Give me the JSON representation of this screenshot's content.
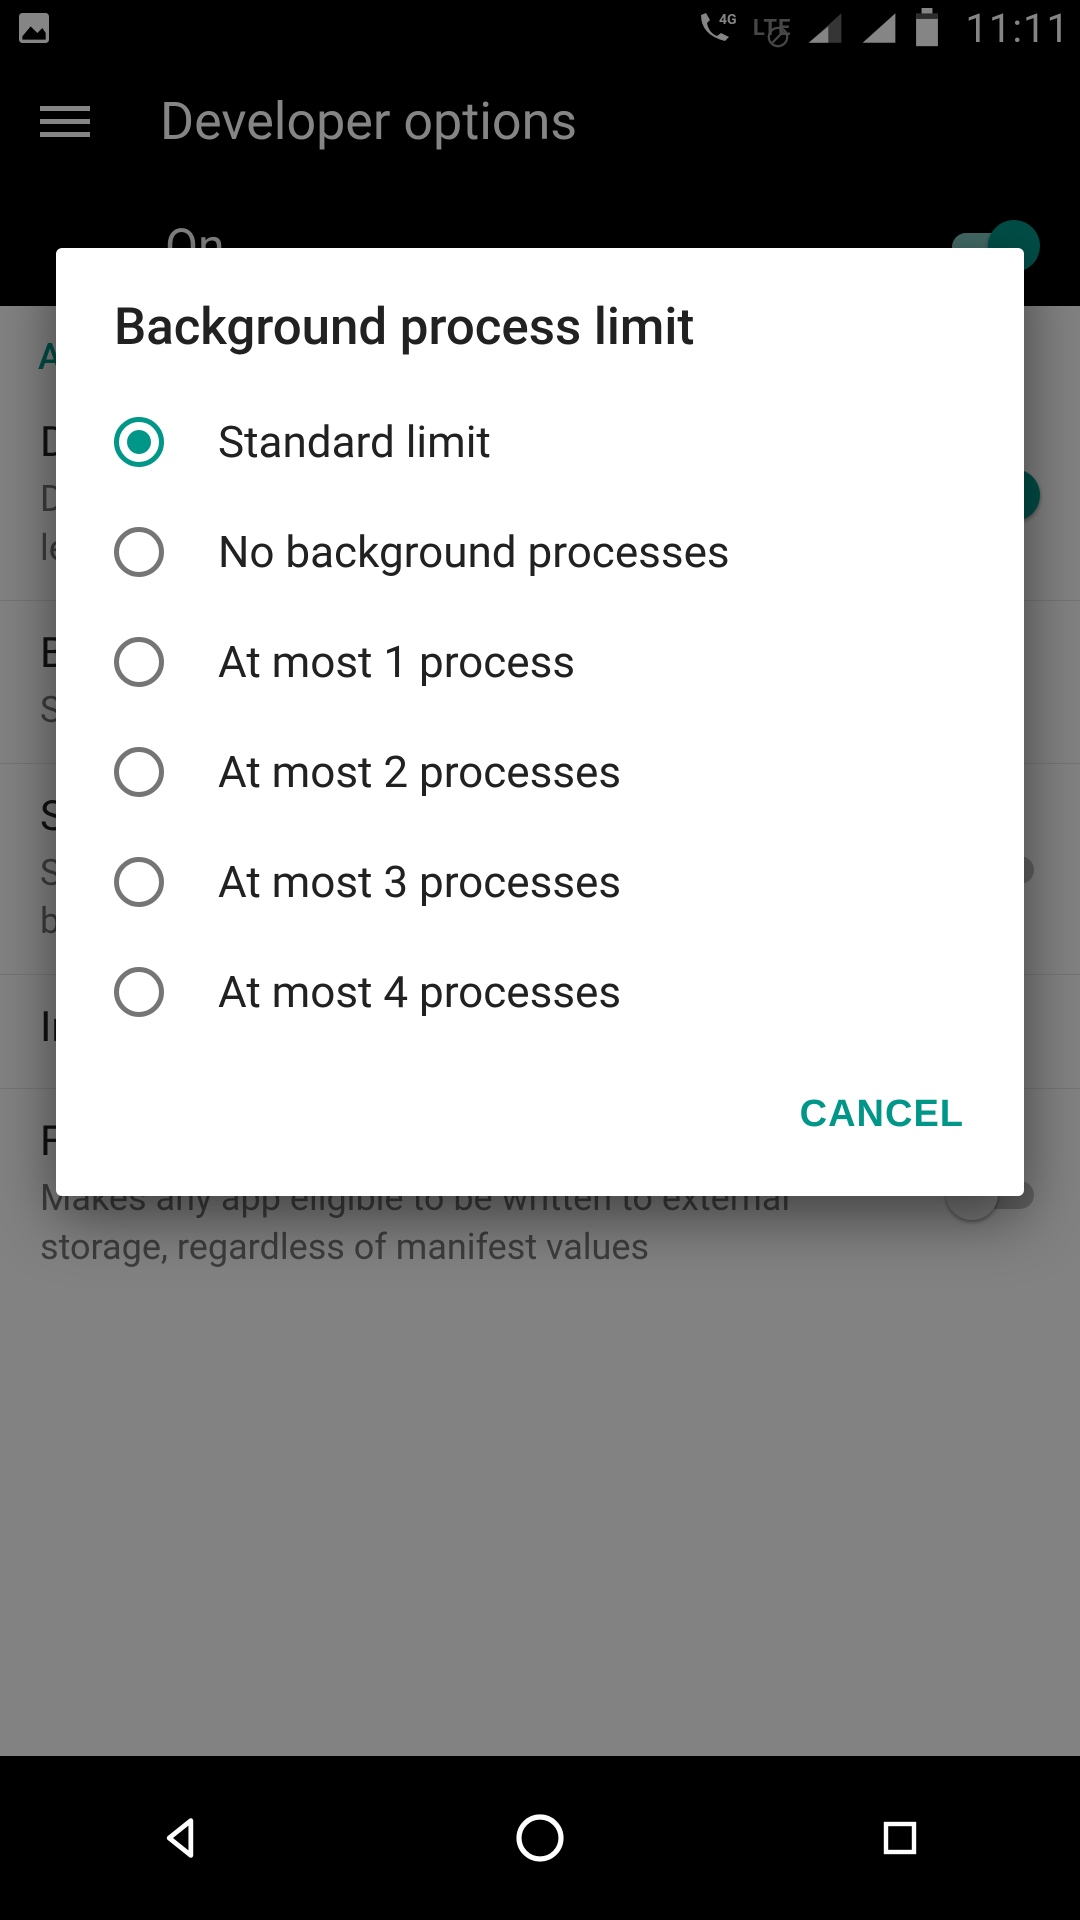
{
  "statusbar": {
    "time": "11:11",
    "network_label": "4G",
    "lte_label": "LTE"
  },
  "appbar": {
    "title": "Developer options"
  },
  "master_toggle": {
    "label": "On"
  },
  "sections": {
    "apps_header": "Apps"
  },
  "settings": {
    "dont_keep": {
      "title": "Don't keep activities",
      "subtitle": "Destroy every activity as soon as the user leaves it"
    },
    "bg_limit": {
      "title": "Background process limit",
      "subtitle": "Standard limit"
    },
    "show_anr": {
      "title": "Show all ANRs",
      "subtitle": "Show App Not Responding dialog for background apps"
    },
    "inactive_apps": {
      "title": "Inactive apps"
    },
    "force_external": {
      "title": "Force allow apps on external",
      "subtitle": "Makes any app eligible to be written to external storage, regardless of manifest values"
    }
  },
  "dialog": {
    "title": "Background process limit",
    "selected_index": 0,
    "options": [
      "Standard limit",
      "No background processes",
      "At most 1 process",
      "At most 2 processes",
      "At most 3 processes",
      "At most 4 processes"
    ],
    "cancel_label": "CANCEL"
  },
  "colors": {
    "accent": "#009688"
  }
}
